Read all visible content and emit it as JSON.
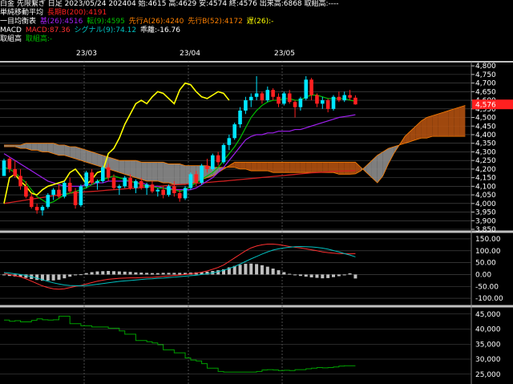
{
  "header": {
    "line1": "白金 先限繋ぎ 日足 2023/05/24 202404 始:4615 高:4629 安:4574 終:4576 出来高:6868 取組高:----",
    "line2_label": "単純移動平均",
    "line2_sma": "長期B(200):4191",
    "line3_label": "一目均衡表",
    "line3_kijun": "基(26):4516",
    "line3_tenkan": "転(9):4595",
    "line3_senkouA": "先行A(26):4240",
    "line3_senkouB": "先行B(52):4172",
    "line3_chikou": "遅(26):-",
    "line4_label": "MACD",
    "line4_macd": "MACD:87.36",
    "line4_signal": "シグナル(9):74.12",
    "line4_osc": "乖離:-16.76",
    "line5_label": "取組高",
    "line5_value": "取組高:-"
  },
  "date_labels": [
    "23/03",
    "23/04",
    "23/05"
  ],
  "price_axis": [
    "4,800",
    "4,750",
    "4,700",
    "4,650",
    "4,600",
    "4,550",
    "4,500",
    "4,450",
    "4,400",
    "4,350",
    "4,300",
    "4,250",
    "4,200",
    "4,150",
    "4,100",
    "4,050",
    "4,000",
    "3,950",
    "3,900",
    "3,850"
  ],
  "last_price": "4,576",
  "macd_axis": [
    "150.00",
    "100.00",
    "50.00",
    "0.00",
    "-50.00",
    "-100.00"
  ],
  "oi_axis": [
    "45,000",
    "40,000",
    "35,000",
    "30,000",
    "25,000"
  ],
  "colors": {
    "up": "#00e5ff",
    "down": "#ff2020",
    "tenkan": "#00c000",
    "kijun": "#a020f0",
    "chikou": "#ffff00",
    "sma": "#d02020",
    "cloud_bear": "#8c8c8c",
    "cloud_bull": "#b05010",
    "macd": "#ff3030",
    "signal": "#00c0c0",
    "hist": "#c0c0c0",
    "oi": "#00a000"
  },
  "chart_data": {
    "type": "candlestick",
    "y_range": [
      3850,
      4810
    ],
    "candles": [
      [
        4160,
        4260,
        4160,
        4250
      ],
      [
        4260,
        4270,
        4180,
        4200
      ],
      [
        4200,
        4250,
        4150,
        4160
      ],
      [
        4160,
        4200,
        4080,
        4100
      ],
      [
        4100,
        4130,
        4030,
        4040
      ],
      [
        4040,
        4060,
        3970,
        3980
      ],
      [
        3980,
        4000,
        3940,
        3960
      ],
      [
        3960,
        3990,
        3930,
        3980
      ],
      [
        3980,
        4060,
        3970,
        4050
      ],
      [
        4050,
        4090,
        4020,
        4080
      ],
      [
        4080,
        4110,
        4030,
        4040
      ],
      [
        4040,
        4130,
        4030,
        4120
      ],
      [
        4120,
        4150,
        4060,
        4070
      ],
      [
        4070,
        4090,
        3970,
        3990
      ],
      [
        3990,
        4110,
        3980,
        4100
      ],
      [
        4100,
        4190,
        4090,
        4180
      ],
      [
        4180,
        4200,
        4110,
        4120
      ],
      [
        4120,
        4140,
        4080,
        4130
      ],
      [
        4130,
        4220,
        4120,
        4210
      ],
      [
        4210,
        4230,
        4130,
        4150
      ],
      [
        4150,
        4170,
        4080,
        4090
      ],
      [
        4090,
        4110,
        4050,
        4100
      ],
      [
        4100,
        4160,
        4090,
        4150
      ],
      [
        4150,
        4170,
        4080,
        4090
      ],
      [
        4090,
        4140,
        4060,
        4130
      ],
      [
        4130,
        4150,
        4080,
        4090
      ],
      [
        4090,
        4120,
        4050,
        4110
      ],
      [
        4110,
        4130,
        4060,
        4070
      ],
      [
        4070,
        4090,
        4040,
        4080
      ],
      [
        4080,
        4100,
        4030,
        4050
      ],
      [
        4050,
        4110,
        4040,
        4100
      ],
      [
        4100,
        4130,
        4040,
        4060
      ],
      [
        4060,
        4080,
        4010,
        4030
      ],
      [
        4030,
        4100,
        4020,
        4090
      ],
      [
        4090,
        4180,
        4080,
        4170
      ],
      [
        4170,
        4190,
        4100,
        4120
      ],
      [
        4120,
        4230,
        4110,
        4220
      ],
      [
        4220,
        4260,
        4180,
        4200
      ],
      [
        4200,
        4290,
        4190,
        4280
      ],
      [
        4280,
        4300,
        4220,
        4240
      ],
      [
        4240,
        4350,
        4230,
        4340
      ],
      [
        4340,
        4400,
        4310,
        4380
      ],
      [
        4380,
        4470,
        4370,
        4460
      ],
      [
        4460,
        4560,
        4440,
        4540
      ],
      [
        4540,
        4620,
        4520,
        4600
      ],
      [
        4600,
        4640,
        4560,
        4620
      ],
      [
        4620,
        4740,
        4600,
        4640
      ],
      [
        4640,
        4650,
        4580,
        4600
      ],
      [
        4600,
        4680,
        4590,
        4660
      ],
      [
        4660,
        4670,
        4600,
        4620
      ],
      [
        4620,
        4640,
        4560,
        4580
      ],
      [
        4580,
        4650,
        4570,
        4640
      ],
      [
        4640,
        4660,
        4580,
        4590
      ],
      [
        4590,
        4600,
        4500,
        4560
      ],
      [
        4560,
        4620,
        4540,
        4610
      ],
      [
        4610,
        4740,
        4600,
        4720
      ],
      [
        4720,
        4730,
        4600,
        4630
      ],
      [
        4630,
        4640,
        4560,
        4580
      ],
      [
        4580,
        4620,
        4550,
        4600
      ],
      [
        4600,
        4610,
        4530,
        4550
      ],
      [
        4550,
        4630,
        4540,
        4620
      ],
      [
        4620,
        4650,
        4590,
        4600
      ],
      [
        4600,
        4650,
        4590,
        4630
      ],
      [
        4630,
        4660,
        4600,
        4615
      ],
      [
        4615,
        4629,
        4574,
        4576
      ]
    ],
    "tenkan": [
      4210,
      4200,
      4180,
      4150,
      4120,
      4080,
      4040,
      4020,
      4000,
      4010,
      4030,
      4050,
      4060,
      4070,
      4080,
      4090,
      4110,
      4130,
      4140,
      4150,
      4160,
      4150,
      4140,
      4130,
      4120,
      4110,
      4100,
      4100,
      4090,
      4090,
      4080,
      4080,
      4070,
      4080,
      4100,
      4120,
      4140,
      4160,
      4180,
      4210,
      4250,
      4290,
      4330,
      4380,
      4440,
      4500,
      4540,
      4570,
      4590,
      4600,
      4600,
      4610,
      4610,
      4600,
      4600,
      4620,
      4630,
      4630,
      4620,
      4610,
      4610,
      4610,
      4610,
      4600,
      4595
    ],
    "kijun": [
      4290,
      4270,
      4250,
      4230,
      4210,
      4190,
      4170,
      4150,
      4130,
      4120,
      4110,
      4100,
      4100,
      4100,
      4100,
      4110,
      4110,
      4120,
      4120,
      4130,
      4130,
      4130,
      4130,
      4130,
      4120,
      4120,
      4110,
      4100,
      4100,
      4090,
      4090,
      4080,
      4080,
      4080,
      4080,
      4090,
      4110,
      4130,
      4150,
      4180,
      4210,
      4250,
      4290,
      4330,
      4370,
      4390,
      4400,
      4400,
      4410,
      4410,
      4420,
      4420,
      4420,
      4430,
      4430,
      4440,
      4450,
      4460,
      4470,
      4480,
      4490,
      4500,
      4505,
      4510,
      4516
    ],
    "chikou": [
      4000,
      4150,
      4170,
      4130,
      4100,
      4060,
      4050,
      4080,
      4100,
      4110,
      4120,
      4130,
      4180,
      4200,
      4160,
      4110,
      4140,
      4180,
      4190,
      4290,
      4320,
      4380,
      4460,
      4520,
      4580,
      4600,
      4580,
      4620,
      4650,
      4640,
      4610,
      4580,
      4660,
      4700,
      4690,
      4650,
      4620,
      4610,
      4630,
      4650,
      4640,
      4600
    ],
    "senkou_a": [
      4330,
      4330,
      4330,
      4320,
      4320,
      4310,
      4310,
      4300,
      4300,
      4290,
      4280,
      4280,
      4270,
      4260,
      4250,
      4240,
      4230,
      4220,
      4210,
      4200,
      4190,
      4180,
      4170,
      4160,
      4150,
      4140,
      4130,
      4130,
      4130,
      4120,
      4120,
      4110,
      4110,
      4110,
      4120,
      4120,
      4140,
      4150,
      4160,
      4180,
      4200,
      4220,
      4240,
      4240,
      4240,
      4240,
      4240,
      4240,
      4240,
      4240,
      4240,
      4240,
      4240,
      4240,
      4240,
      4240,
      4240,
      4240,
      4240,
      4240,
      4240,
      4240,
      4240,
      4240,
      4240,
      4210,
      4180,
      4150,
      4120,
      4160,
      4230,
      4290,
      4340,
      4390,
      4420,
      4450,
      4480,
      4500,
      4510,
      4520,
      4530,
      4540,
      4550,
      4560,
      4570
    ],
    "senkou_b": [
      4340,
      4340,
      4340,
      4340,
      4350,
      4350,
      4350,
      4350,
      4350,
      4350,
      4340,
      4340,
      4330,
      4330,
      4320,
      4310,
      4300,
      4290,
      4280,
      4270,
      4260,
      4250,
      4250,
      4250,
      4250,
      4240,
      4240,
      4240,
      4240,
      4240,
      4230,
      4230,
      4230,
      4220,
      4220,
      4220,
      4220,
      4220,
      4210,
      4210,
      4210,
      4210,
      4210,
      4200,
      4200,
      4190,
      4190,
      4190,
      4190,
      4180,
      4180,
      4180,
      4180,
      4180,
      4180,
      4180,
      4180,
      4180,
      4180,
      4180,
      4180,
      4170,
      4170,
      4170,
      4172,
      4190,
      4220,
      4250,
      4280,
      4300,
      4320,
      4330,
      4340,
      4350,
      4360,
      4370,
      4380,
      4380,
      4390,
      4390,
      4390,
      4390,
      4390,
      4390,
      4390
    ],
    "sma200": [
      4000,
      4005,
      4010,
      4015,
      4020,
      4025,
      4030,
      4035,
      4040,
      4045,
      4050,
      4055,
      4060,
      4062,
      4065,
      4068,
      4070,
      4072,
      4075,
      4078,
      4080,
      4082,
      4085,
      4088,
      4090,
      4092,
      4095,
      4098,
      4100,
      4102,
      4105,
      4108,
      4110,
      4112,
      4115,
      4118,
      4120,
      4122,
      4125,
      4128,
      4130,
      4133,
      4136,
      4139,
      4142,
      4145,
      4148,
      4151,
      4154,
      4157,
      4160,
      4163,
      4166,
      4169,
      4172,
      4175,
      4178,
      4180,
      4182,
      4184,
      4186,
      4188,
      4189,
      4190,
      4191
    ],
    "macd": [
      5,
      0,
      -5,
      -10,
      -18,
      -28,
      -38,
      -48,
      -55,
      -60,
      -62,
      -60,
      -55,
      -50,
      -46,
      -40,
      -34,
      -28,
      -24,
      -20,
      -18,
      -16,
      -15,
      -14,
      -14,
      -13,
      -12,
      -12,
      -10,
      -8,
      -6,
      -4,
      -2,
      0,
      3,
      6,
      10,
      15,
      22,
      30,
      40,
      55,
      70,
      85,
      100,
      112,
      120,
      125,
      128,
      128,
      126,
      122,
      118,
      115,
      112,
      108,
      104,
      100,
      95,
      92,
      90,
      88,
      88,
      87,
      87.36
    ],
    "signal": [
      8,
      6,
      3,
      0,
      -4,
      -9,
      -15,
      -22,
      -29,
      -35,
      -40,
      -44,
      -46,
      -47,
      -47,
      -46,
      -44,
      -41,
      -38,
      -35,
      -32,
      -29,
      -27,
      -25,
      -23,
      -21,
      -19,
      -18,
      -16,
      -15,
      -13,
      -11,
      -9,
      -7,
      -5,
      -3,
      0,
      3,
      7,
      12,
      18,
      25,
      34,
      44,
      55,
      66,
      76,
      86,
      95,
      103,
      108,
      112,
      115,
      117,
      118,
      117,
      116,
      114,
      111,
      107,
      101,
      95,
      88,
      82,
      74.12
    ],
    "hist": [
      -3,
      -6,
      -8,
      -10,
      -14,
      -19,
      -23,
      -26,
      -26,
      -25,
      -22,
      -16,
      -9,
      -3,
      1,
      6,
      10,
      13,
      14,
      15,
      14,
      13,
      12,
      11,
      9,
      8,
      7,
      6,
      6,
      7,
      7,
      7,
      7,
      7,
      8,
      9,
      10,
      12,
      15,
      18,
      22,
      30,
      36,
      41,
      45,
      46,
      44,
      39,
      33,
      25,
      18,
      10,
      3,
      -2,
      -6,
      -9,
      -12,
      -14,
      -16,
      -15,
      -11,
      -7,
      0,
      5,
      -16.76
    ],
    "oi": [
      43000,
      42600,
      42800,
      42400,
      42400,
      42900,
      43400,
      43100,
      43000,
      43100,
      44300,
      44300,
      41800,
      41800,
      41100,
      41100,
      40700,
      40700,
      40700,
      40300,
      40300,
      39400,
      38300,
      38300,
      36200,
      36200,
      35800,
      35400,
      34800,
      33100,
      33100,
      32100,
      32100,
      30400,
      29700,
      29400,
      28500,
      27000,
      27000,
      25900,
      25700,
      25700,
      25700,
      25700,
      25700,
      25700,
      25900,
      26400,
      26500,
      26400,
      26200,
      26300,
      26200,
      26500,
      26500,
      26800,
      27000,
      27200,
      27100,
      27200,
      27400,
      27700,
      27800,
      27800,
      27800
    ],
    "y_ticks": [
      "4,800",
      "4,750",
      "4,700",
      "4,650",
      "4,600",
      "4,550",
      "4,500",
      "4,450",
      "4,400",
      "4,350",
      "4,300",
      "4,250",
      "4,200",
      "4,150",
      "4,100",
      "4,050",
      "4,000",
      "3,950",
      "3,900",
      "3,850"
    ]
  }
}
